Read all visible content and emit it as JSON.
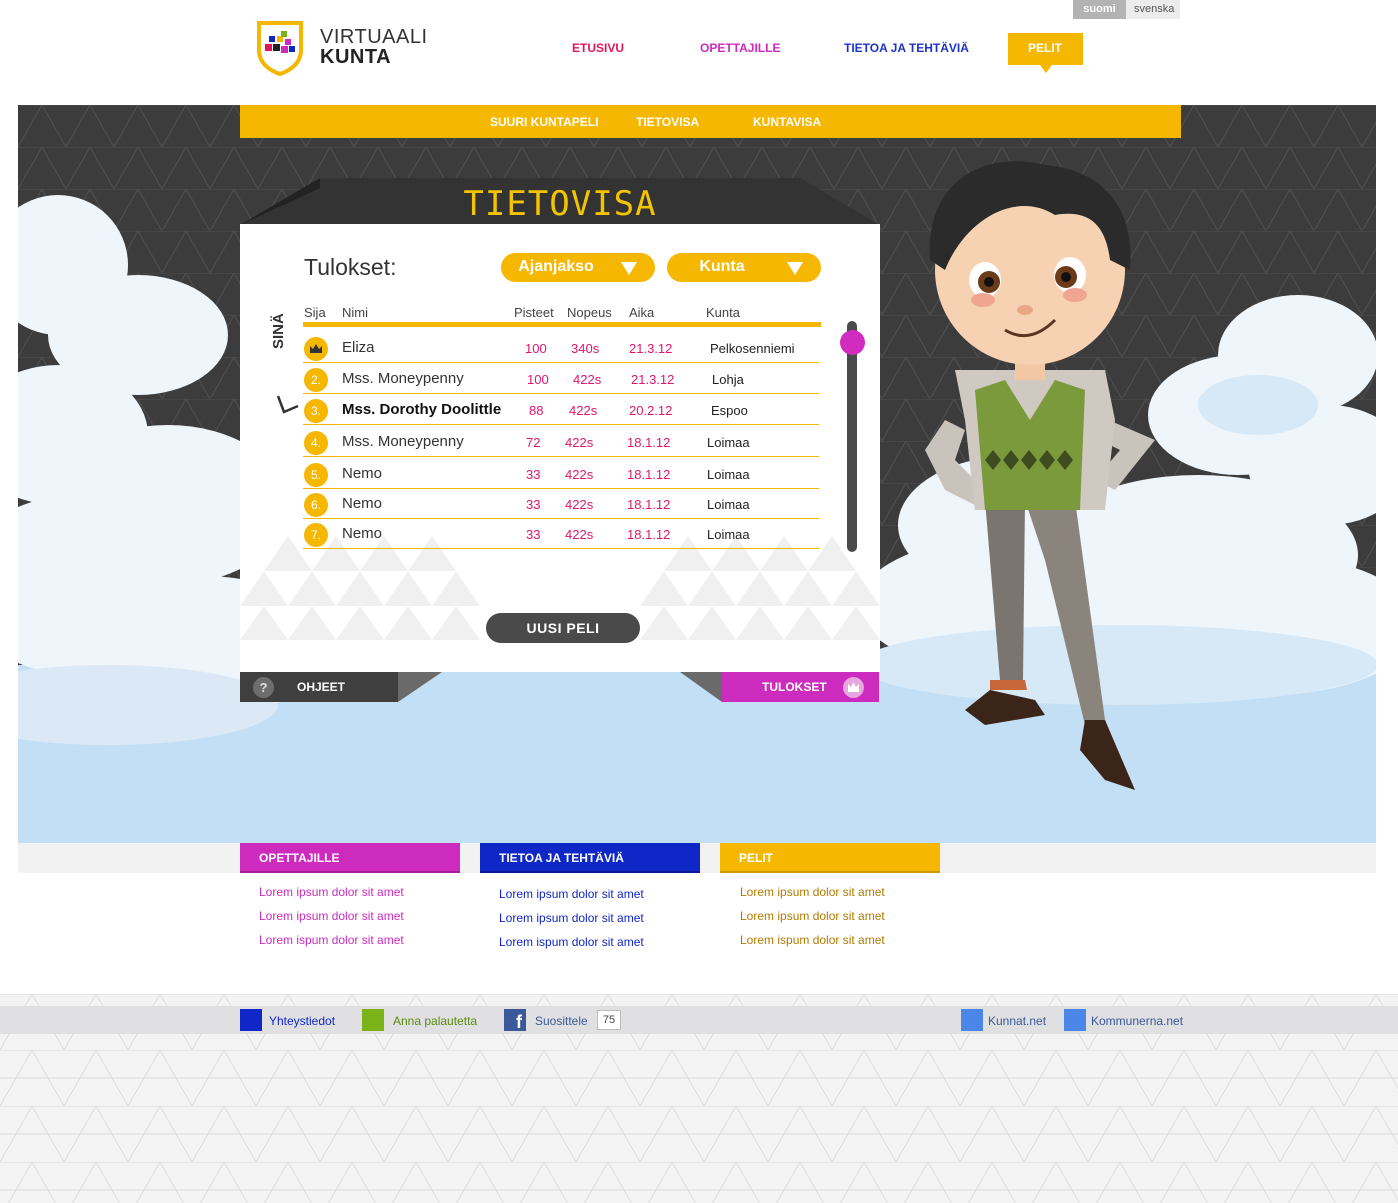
{
  "lang": {
    "active": "suomi",
    "other": "svenska"
  },
  "logo": {
    "line1": "VIRTUAALI",
    "line2": "KUNTA"
  },
  "nav": {
    "etusivu": "ETUSIVU",
    "opettajille": "OPETTAJILLE",
    "tietoa": "TIETOA JA TEHTÄVIÄ",
    "pelit": "PELIT"
  },
  "subnav": {
    "item1": "SUURI KUNTAPELI",
    "item2": "TIETOVISA",
    "item3": "KUNTAVISA"
  },
  "quiz": {
    "title": "TIETOVISA",
    "results_label": "Tulokset:",
    "dropdown1": "Ajanjakso",
    "dropdown2": "Kunta",
    "you_label": "SINÄ",
    "columns": {
      "rank": "Sija",
      "name": "Nimi",
      "points": "Pisteet",
      "speed": "Nopeus",
      "time": "Aika",
      "municipality": "Kunta"
    },
    "rows": [
      {
        "rank": "",
        "name": "Eliza",
        "points": "100",
        "speed": "340s",
        "date": "21.3.12",
        "municipality": "Pelkosenniemi"
      },
      {
        "rank": "2.",
        "name": "Mss. Moneypenny",
        "points": "100",
        "speed": "422s",
        "date": "21.3.12",
        "municipality": "Lohja"
      },
      {
        "rank": "3.",
        "name": "Mss. Dorothy Doolittle",
        "points": "88",
        "speed": "422s",
        "date": "20.2.12",
        "municipality": "Espoo"
      },
      {
        "rank": "4.",
        "name": "Mss. Moneypenny",
        "points": "72",
        "speed": "422s",
        "date": "18.1.12",
        "municipality": "Loimaa"
      },
      {
        "rank": "5.",
        "name": "Nemo",
        "points": "33",
        "speed": "422s",
        "date": "18.1.12",
        "municipality": "Loimaa"
      },
      {
        "rank": "6.",
        "name": "Nemo",
        "points": "33",
        "speed": "422s",
        "date": "18.1.12",
        "municipality": "Loimaa"
      },
      {
        "rank": "7.",
        "name": "Nemo",
        "points": "33",
        "speed": "422s",
        "date": "18.1.12",
        "municipality": "Loimaa"
      }
    ],
    "new_game": "UUSI PELI",
    "help": "OHJEET",
    "help_icon": "?",
    "results_button": "TULOKSET"
  },
  "footer_sections": {
    "s1": {
      "title": "OPETTAJILLE",
      "links": [
        "Lorem ipsum dolor sit amet",
        "Lorem ipsum dolor sit amet",
        "Lorem ispum dolor sit amet"
      ]
    },
    "s2": {
      "title": "TIETOA JA TEHTÄVIÄ",
      "links": [
        "Lorem ipsum dolor sit amet",
        "Lorem ipsum dolor sit amet",
        "Lorem ispum dolor sit amet"
      ]
    },
    "s3": {
      "title": "PELIT",
      "links": [
        "Lorem ipsum dolor sit amet",
        "Lorem ipsum dolor sit amet",
        "Lorem ispum dolor sit amet"
      ]
    }
  },
  "bottom_bar": {
    "contact": "Yhteystiedot",
    "feedback": "Anna palautetta",
    "recommend": "Suosittele",
    "recommend_count": "75",
    "kunnat": "Kunnat.net",
    "kommunerna": "Kommunerna.net"
  },
  "colors": {
    "yellow": "#f5b700",
    "magenta": "#cc2bbe",
    "blue": "#1027c8",
    "red": "#e0165b"
  }
}
